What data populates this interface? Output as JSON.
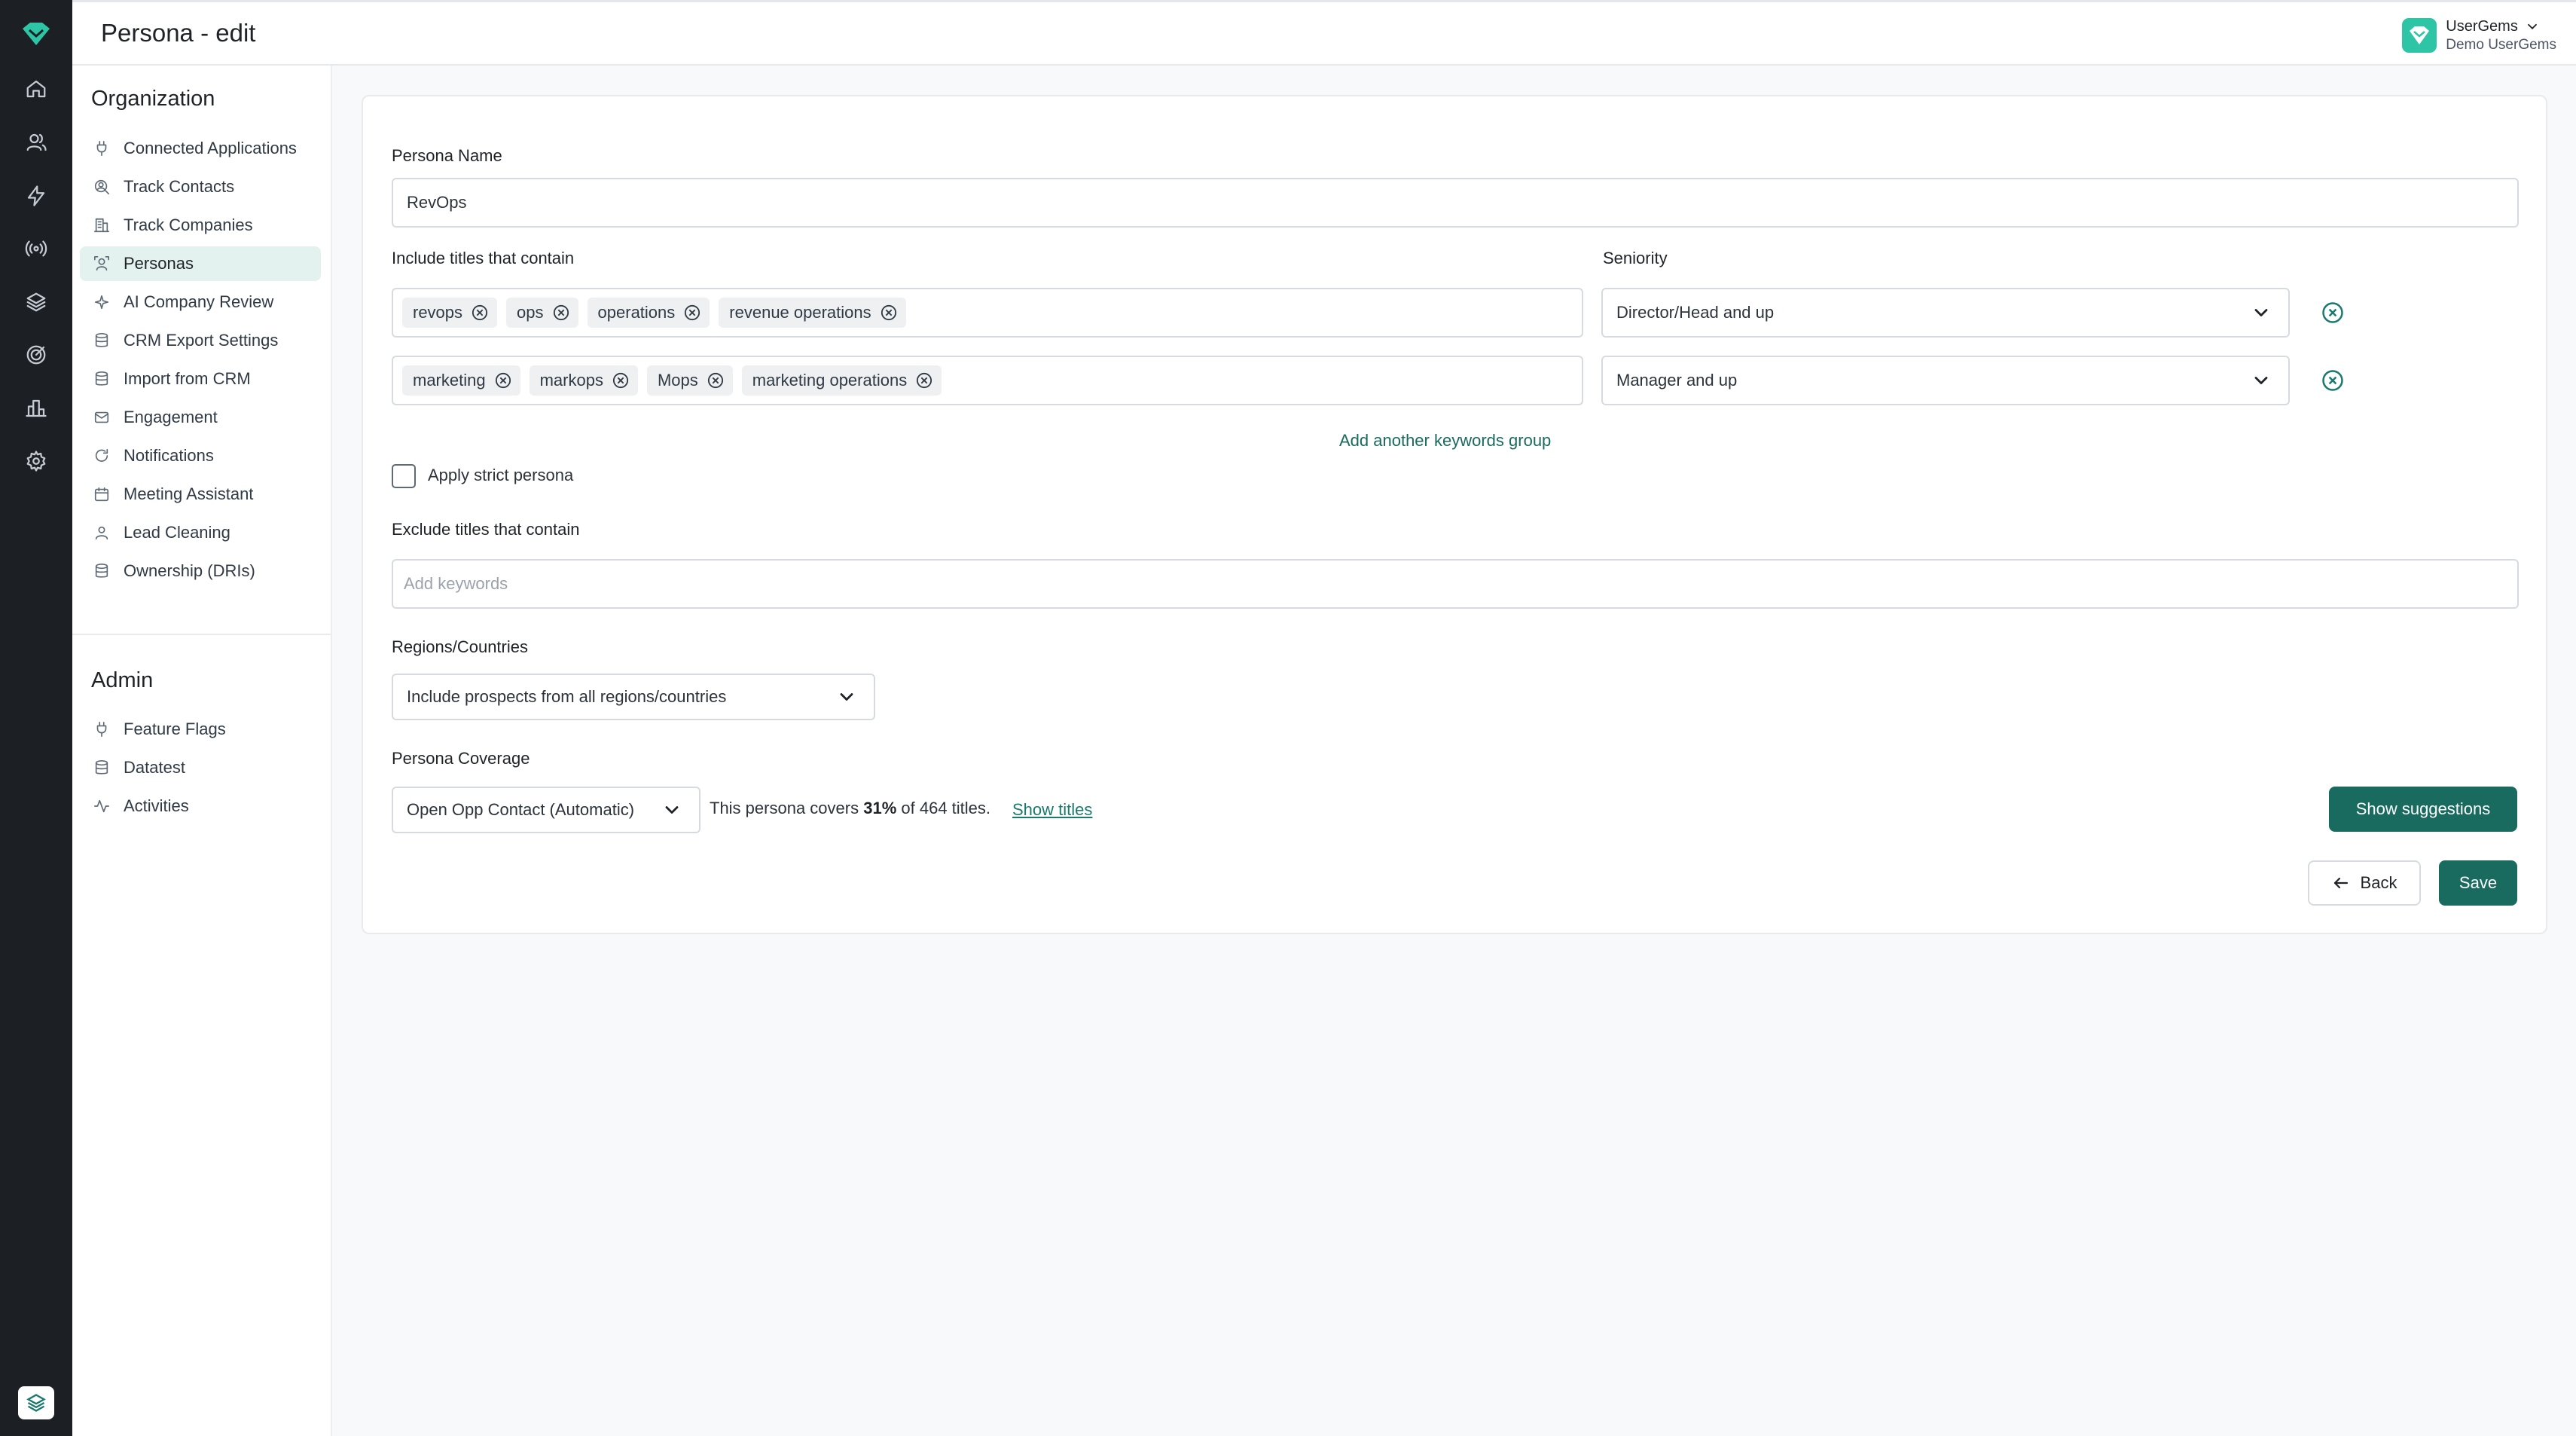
{
  "header": {
    "title": "Persona - edit",
    "account_name": "UserGems",
    "account_sub": "Demo UserGems"
  },
  "rail": {
    "icons": [
      "home-icon",
      "users-icon",
      "bolt-icon",
      "broadcast-icon",
      "layers-icon",
      "target-icon",
      "bar-chart-icon",
      "gear-icon"
    ]
  },
  "sidebar": {
    "org_title": "Organization",
    "org_items": [
      {
        "label": "Connected Applications",
        "icon": "plug-icon"
      },
      {
        "label": "Track Contacts",
        "icon": "contact-search-icon"
      },
      {
        "label": "Track Companies",
        "icon": "building-icon"
      },
      {
        "label": "Personas",
        "icon": "persona-icon"
      },
      {
        "label": "AI Company Review",
        "icon": "sparkle-icon"
      },
      {
        "label": "CRM Export Settings",
        "icon": "database-icon"
      },
      {
        "label": "Import from CRM",
        "icon": "database-icon"
      },
      {
        "label": "Engagement",
        "icon": "mail-icon"
      },
      {
        "label": "Notifications",
        "icon": "refresh-icon"
      },
      {
        "label": "Meeting Assistant",
        "icon": "calendar-icon"
      },
      {
        "label": "Lead Cleaning",
        "icon": "user-icon"
      },
      {
        "label": "Ownership (DRIs)",
        "icon": "database-icon"
      }
    ],
    "admin_title": "Admin",
    "admin_items": [
      {
        "label": "Feature Flags",
        "icon": "plug-icon"
      },
      {
        "label": "Datatest",
        "icon": "database-icon"
      },
      {
        "label": "Activities",
        "icon": "activity-icon"
      }
    ]
  },
  "form": {
    "persona_name_label": "Persona Name",
    "persona_name_value": "RevOps",
    "include_label": "Include titles that contain",
    "seniority_label": "Seniority",
    "groups": [
      {
        "tags": [
          "revops",
          "ops",
          "operations",
          "revenue operations"
        ],
        "seniority": "Director/Head and up"
      },
      {
        "tags": [
          "marketing",
          "markops",
          "Mops",
          "marketing operations"
        ],
        "seniority": "Manager and up"
      }
    ],
    "add_group_label": "Add another keywords group",
    "strict_label": "Apply strict persona",
    "exclude_label": "Exclude titles that contain",
    "exclude_placeholder": "Add keywords",
    "regions_label": "Regions/Countries",
    "regions_value": "Include prospects from all regions/countries",
    "coverage_label": "Persona Coverage",
    "coverage_select": "Open Opp Contact (Automatic)",
    "coverage_prefix": "This persona covers",
    "coverage_percent": "31%",
    "coverage_suffix": "of 464 titles.",
    "show_titles_label": "Show titles",
    "show_suggestions_label": "Show suggestions",
    "back_label": "Back",
    "save_label": "Save"
  },
  "colors": {
    "accent": "#186b5e",
    "rail_bg": "#1c2025",
    "active_bg": "#e3f1ef",
    "logo": "#2ec4a6"
  }
}
